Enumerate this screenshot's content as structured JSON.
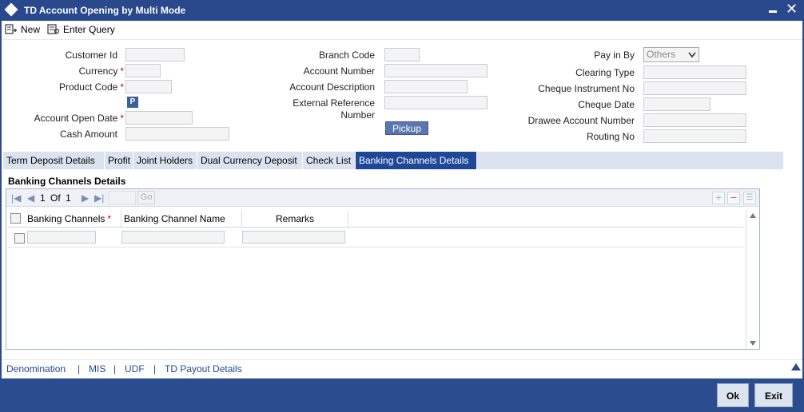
{
  "window": {
    "title": "TD Account Opening by Multi Mode"
  },
  "toolbar": {
    "new_label": "New",
    "enter_query_label": "Enter Query"
  },
  "form": {
    "left": {
      "customer_id_label": "Customer Id",
      "currency_label": "Currency",
      "product_code_label": "Product Code",
      "product_lookup_label": "P",
      "account_open_date_label": "Account Open Date",
      "cash_amount_label": "Cash Amount"
    },
    "middle": {
      "branch_code_label": "Branch Code",
      "account_number_label": "Account Number",
      "account_description_label": "Account Description",
      "external_reference_label_1": "External Reference",
      "external_reference_label_2": "Number",
      "pickup_label": "Pickup"
    },
    "right": {
      "pay_in_by_label": "Pay in By",
      "pay_in_by_value": "Others",
      "clearing_type_label": "Clearing Type",
      "cheque_instrument_label": "Cheque Instrument No",
      "cheque_date_label": "Cheque Date",
      "drawee_account_label": "Drawee Account Number",
      "routing_no_label": "Routing No"
    },
    "required_marker": "*"
  },
  "tabs": [
    {
      "label": "Term Deposit Details",
      "active": false
    },
    {
      "label": "Profit",
      "active": false
    },
    {
      "label": "Joint Holders",
      "active": false
    },
    {
      "label": "Dual Currency Deposit",
      "active": false
    },
    {
      "label": "Check List",
      "active": false
    },
    {
      "label": "Banking Channels Details",
      "active": true
    }
  ],
  "section": {
    "title": "Banking Channels Details",
    "pager": {
      "page_current": "1",
      "page_of": "Of",
      "page_total": "1",
      "go_label": "Go"
    },
    "columns": [
      "Banking Channels",
      "Banking Channel Name",
      "Remarks"
    ]
  },
  "footer_links": [
    "Denomination",
    "MIS",
    "UDF",
    "TD Payout Details"
  ],
  "footer_separator": "|",
  "buttons": {
    "ok_label": "Ok",
    "exit_label": "Exit"
  },
  "colors": {
    "title_bar": "#29498c",
    "active_tab": "#1f4797",
    "tab_bar": "#dbe3f0",
    "link": "#1f4797"
  }
}
